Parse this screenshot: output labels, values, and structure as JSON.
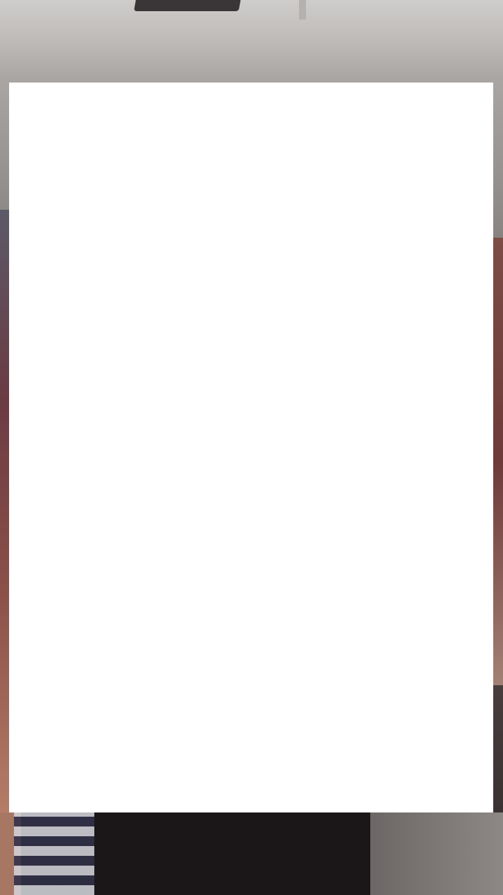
{
  "screen": {
    "title": "",
    "colors": {
      "overlay": "#ffffff",
      "backdrop_top": "#cfcdcb",
      "backdrop_bottom": "#2a2628"
    }
  },
  "overlay_card": {
    "content": ""
  }
}
